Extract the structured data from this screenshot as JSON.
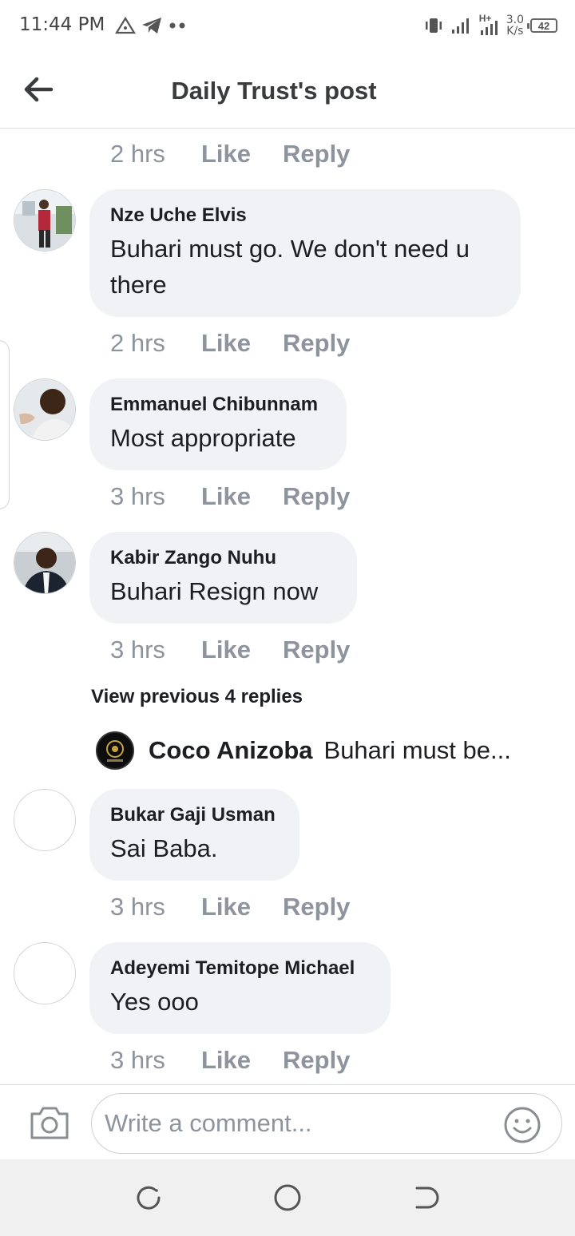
{
  "status_bar": {
    "time": "11:44 PM",
    "network": "H+",
    "speed_value": "3.0",
    "speed_unit": "K/s",
    "battery": "42"
  },
  "header": {
    "title": "Daily Trust's post"
  },
  "actions": {
    "like": "Like",
    "reply": "Reply"
  },
  "top_meta": {
    "time": "2 hrs"
  },
  "comments": [
    {
      "name": "Nze Uche Elvis",
      "text": "Buhari must go. We don't need u there",
      "time": "2 hrs"
    },
    {
      "name": "Emmanuel Chibunnam",
      "text": "Most appropriate",
      "time": "3 hrs"
    },
    {
      "name": "Kabir Zango Nuhu",
      "text": "Buhari Resign now",
      "time": "3 hrs"
    },
    {
      "name": "Bukar Gaji Usman",
      "text": "Sai Baba.",
      "time": "3 hrs"
    },
    {
      "name": "Adeyemi Temitope Michael",
      "text": "Yes ooo",
      "time": "3 hrs"
    }
  ],
  "view_previous": "View previous 4 replies",
  "reply_preview": {
    "name": "Coco Anizoba",
    "text": "Buhari must be..."
  },
  "composer": {
    "placeholder": "Write a comment..."
  },
  "colors": {
    "bubble": "#f0f2f5",
    "meta_text": "#8d949e",
    "name_text": "#1c1e21"
  }
}
